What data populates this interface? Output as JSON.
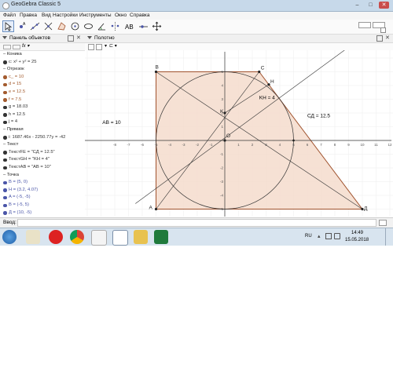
{
  "window": {
    "title": "GeoGebra Classic 5",
    "minimize": "–",
    "maximize": "□",
    "close": "✕"
  },
  "menu": [
    "Файл",
    "Правка",
    "Вид",
    "Настройки",
    "Инструменты",
    "Окно",
    "Справка"
  ],
  "algebra_panel": {
    "title": "Панель объектов",
    "rows": [
      {
        "kind": "cat",
        "text": "Коника"
      },
      {
        "kind": "item",
        "text": "c: x² + y² = 25",
        "color": "#333333"
      },
      {
        "kind": "cat",
        "text": "Отрезок"
      },
      {
        "kind": "item",
        "text": "c_ = 10",
        "color": "#a35b2e"
      },
      {
        "kind": "item",
        "text": "d = 15",
        "color": "#a35b2e"
      },
      {
        "kind": "item",
        "text": "e = 12.5",
        "color": "#a35b2e"
      },
      {
        "kind": "item",
        "text": "f = 7.5",
        "color": "#a35b2e"
      },
      {
        "kind": "item",
        "text": "g = 18.03",
        "color": "#333333"
      },
      {
        "kind": "item",
        "text": "h = 12.5",
        "color": "#333333"
      },
      {
        "kind": "item",
        "text": "j = 4",
        "color": "#333333"
      },
      {
        "kind": "cat",
        "text": "Прямая"
      },
      {
        "kind": "item",
        "text": "i: 1687.46x - 2250.77y = -42",
        "color": "#333333"
      },
      {
        "kind": "cat",
        "text": "Текст"
      },
      {
        "kind": "item",
        "text": "ТекстFE = \"СД = 12.5\"",
        "color": "#333333"
      },
      {
        "kind": "item",
        "text": "ТекстGH = \"KH = 4\"",
        "color": "#333333"
      },
      {
        "kind": "item",
        "text": "ТекстAB = \"AB = 10\"",
        "color": "#333333"
      },
      {
        "kind": "cat",
        "text": "Точка"
      },
      {
        "kind": "item",
        "text": "B = (5, 0)",
        "color": "#4a55a8"
      },
      {
        "kind": "item",
        "text": "H = (3.2, 4.07)",
        "color": "#4a55a8"
      },
      {
        "kind": "item",
        "text": "A = (-5, -5)",
        "color": "#4a55a8"
      },
      {
        "kind": "item",
        "text": "B = (-5, 5)",
        "color": "#4a55a8"
      },
      {
        "kind": "item",
        "text": "Д = (10, -5)",
        "color": "#4a55a8"
      }
    ]
  },
  "graphics_panel": {
    "title": "Полотно",
    "x_ticks": [
      "-8",
      "-7",
      "-6",
      "-5",
      "-4",
      "-3",
      "-2",
      "-1",
      "1",
      "2",
      "3",
      "4",
      "5",
      "6",
      "7",
      "8",
      "9",
      "10",
      "11",
      "12"
    ],
    "y_ticks": [
      "5",
      "4",
      "3",
      "2",
      "1",
      "-1",
      "-2",
      "-3",
      "-4",
      "-5"
    ],
    "points": {
      "A": "A",
      "B": "B",
      "C": "C",
      "D": "Д",
      "H": "H",
      "K": "K",
      "O": "O"
    },
    "texts": {
      "ab": "AB = 10",
      "kh": "KH = 4",
      "cd": "СД = 12.5"
    },
    "colors": {
      "fill": "#f4dccd",
      "edge": "#a0522d",
      "axis": "#333333"
    }
  },
  "input_bar": {
    "label": "Ввод:"
  },
  "taskbar": {
    "lang": "RU",
    "time": "14:49",
    "date": "15.05.2018"
  }
}
